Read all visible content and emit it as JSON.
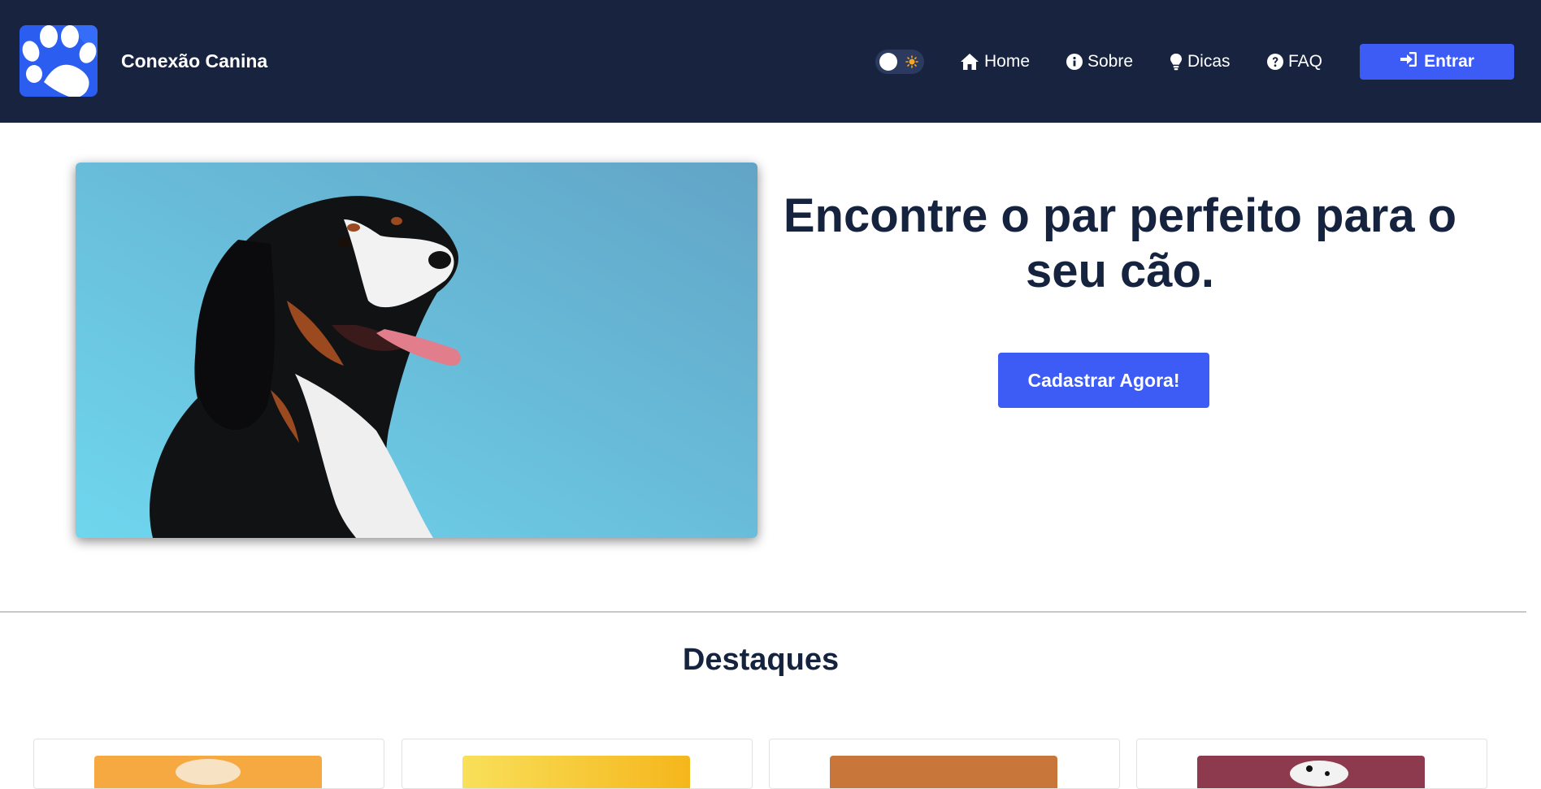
{
  "header": {
    "brand_name": "Conexão Canina",
    "logo_icon": "paw-icon",
    "theme_toggle_icon": "sun-icon",
    "nav": [
      {
        "label": "Home",
        "icon": "home-icon"
      },
      {
        "label": "Sobre",
        "icon": "info-icon"
      },
      {
        "label": "Dicas",
        "icon": "lightbulb-icon"
      },
      {
        "label": "FAQ",
        "icon": "question-icon"
      }
    ],
    "login_label": "Entrar",
    "login_icon": "sign-in-icon"
  },
  "hero": {
    "title": "Encontre o par perfeito para o seu cão.",
    "cta_label": "Cadastrar Agora!"
  },
  "featured": {
    "title": "Destaques",
    "cards": [
      {
        "thumb_color": "#f5a940"
      },
      {
        "thumb_color": "#f7c528"
      },
      {
        "thumb_color": "#c8763a"
      },
      {
        "thumb_color": "#8e3a4e"
      }
    ]
  },
  "colors": {
    "header_bg": "#18233f",
    "accent": "#3d5cf5",
    "text_dark": "#16233f",
    "logo_bg": "#2a5df0"
  }
}
